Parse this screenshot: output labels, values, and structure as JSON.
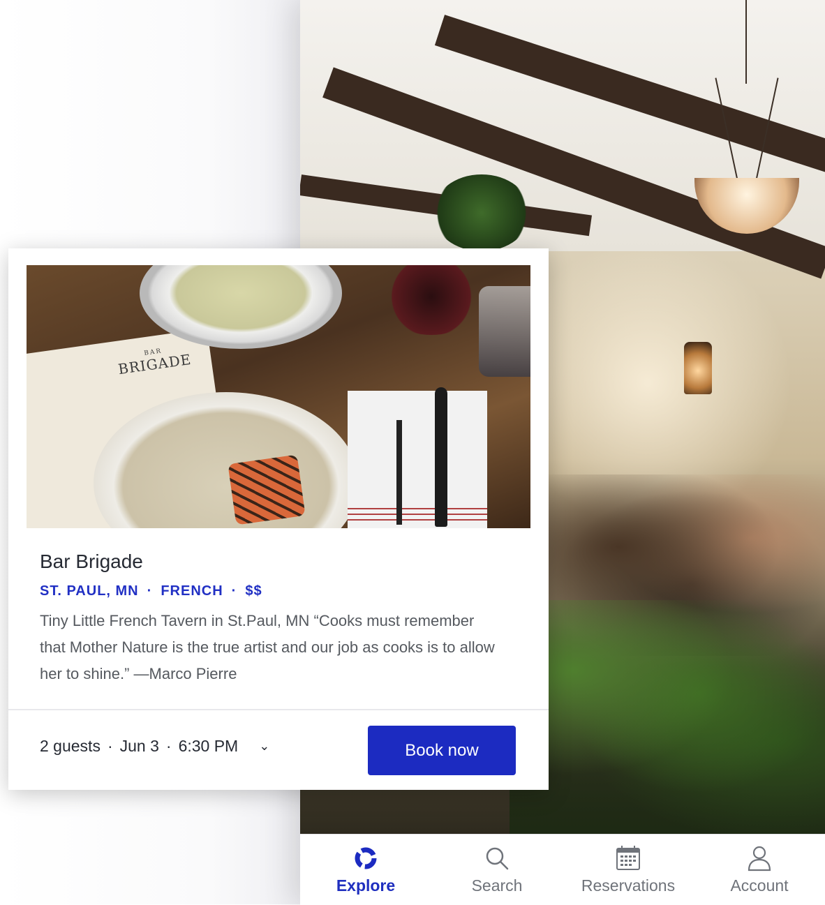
{
  "restaurant": {
    "name": "Bar Brigade",
    "location": "ST. PAUL, MN",
    "cuisine": "FRENCH",
    "price": "$$",
    "meta_separator": "·",
    "description": "Tiny Little French Tavern in St.Paul, MN   “Cooks must remember that Mother Nature is the true artist and our job as cooks is to allow her to shine.” —Marco Pierre",
    "menu_brand_small": "BAR",
    "menu_brand": "BRIGADE"
  },
  "booking": {
    "guests": "2 guests",
    "date": "Jun 3",
    "time": "6:30 PM",
    "separator": "·",
    "chevron": "⌄",
    "book_label": "Book now"
  },
  "tabbar": {
    "items": [
      {
        "label": "Explore",
        "icon": "explore-icon",
        "active": true
      },
      {
        "label": "Search",
        "icon": "search-icon",
        "active": false
      },
      {
        "label": "Reservations",
        "icon": "calendar-icon",
        "active": false
      },
      {
        "label": "Account",
        "icon": "person-icon",
        "active": false
      }
    ]
  },
  "colors": {
    "accent": "#1c2bc1",
    "meta": "#2130c4",
    "title": "#262a33",
    "body_text": "#55595f",
    "tab_inactive": "#6f737a"
  }
}
